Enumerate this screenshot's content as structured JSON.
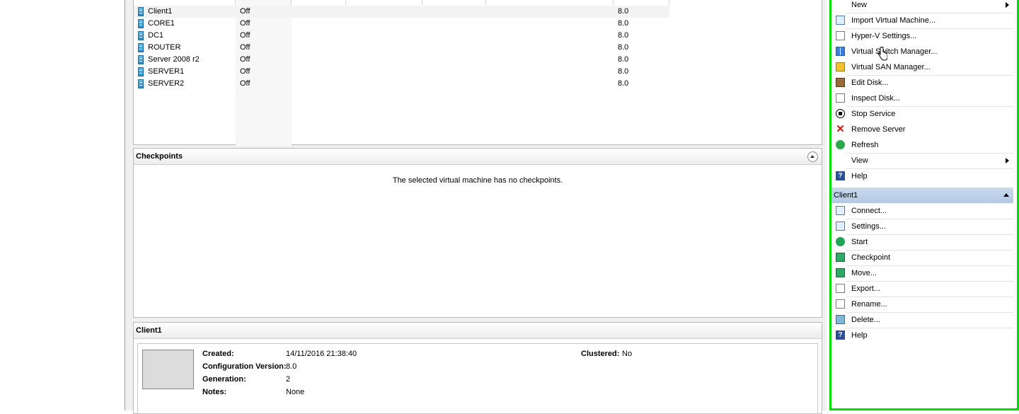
{
  "vm_list": {
    "rows": [
      {
        "name": "Client1",
        "state": "Off",
        "version": "8.0",
        "selected": true
      },
      {
        "name": "CORE1",
        "state": "Off",
        "version": "8.0"
      },
      {
        "name": "DC1",
        "state": "Off",
        "version": "8.0"
      },
      {
        "name": "ROUTER",
        "state": "Off",
        "version": "8.0"
      },
      {
        "name": "Server 2008 r2",
        "state": "Off",
        "version": "8.0"
      },
      {
        "name": "SERVER1",
        "state": "Off",
        "version": "8.0"
      },
      {
        "name": "SERVER2",
        "state": "Off",
        "version": "8.0"
      }
    ]
  },
  "checkpoints": {
    "title": "Checkpoints",
    "empty_message": "The selected virtual machine has no checkpoints."
  },
  "details": {
    "title": "Client1",
    "created_label": "Created:",
    "created_value": "14/11/2016 21:38:40",
    "config_label": "Configuration Version:",
    "config_value": "8.0",
    "generation_label": "Generation:",
    "generation_value": "2",
    "notes_label": "Notes:",
    "notes_value": "None",
    "clustered_label": "Clustered:",
    "clustered_value": "No"
  },
  "actions": {
    "host_items": [
      {
        "label": "New",
        "icon": "none",
        "submenu": true
      },
      {
        "label": "Import Virtual Machine...",
        "icon": "import-icon"
      },
      {
        "label": "Hyper-V Settings...",
        "icon": "settings-doc-icon"
      },
      {
        "label": "Virtual Switch Manager...",
        "icon": "switch-icon"
      },
      {
        "label": "Virtual SAN Manager...",
        "icon": "san-icon"
      },
      {
        "label": "Edit Disk...",
        "icon": "edit-disk-icon"
      },
      {
        "label": "Inspect Disk...",
        "icon": "inspect-disk-icon"
      },
      {
        "label": "Stop Service",
        "icon": "stop-icon"
      },
      {
        "label": "Remove Server",
        "icon": "remove-icon"
      },
      {
        "label": "Refresh",
        "icon": "refresh-icon"
      },
      {
        "label": "View",
        "icon": "none",
        "submenu": true
      },
      {
        "label": "Help",
        "icon": "help-icon"
      }
    ],
    "vm_section_title": "Client1",
    "vm_items": [
      {
        "label": "Connect...",
        "icon": "connect-icon"
      },
      {
        "label": "Settings...",
        "icon": "vm-settings-icon"
      },
      {
        "label": "Start",
        "icon": "start-icon"
      },
      {
        "label": "Checkpoint",
        "icon": "checkpoint-icon"
      },
      {
        "label": "Move...",
        "icon": "move-icon"
      },
      {
        "label": "Export...",
        "icon": "export-icon"
      },
      {
        "label": "Rename...",
        "icon": "rename-icon"
      },
      {
        "label": "Delete...",
        "icon": "delete-icon"
      },
      {
        "label": "Help",
        "icon": "help-icon"
      }
    ]
  }
}
